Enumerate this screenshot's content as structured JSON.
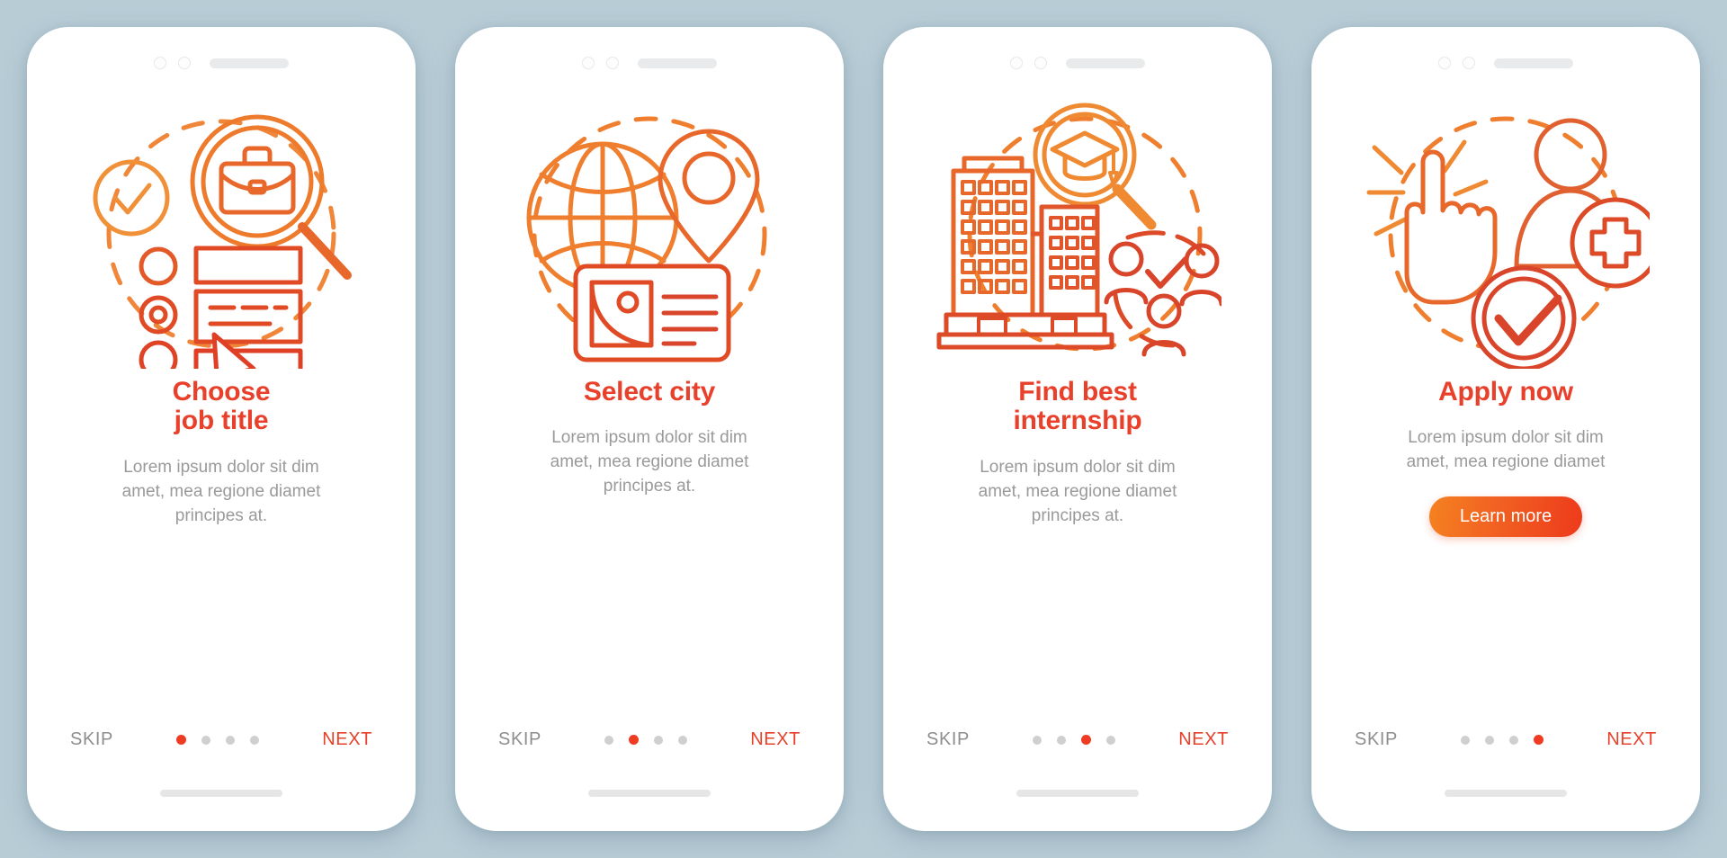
{
  "background_color": "#b8ccd6",
  "accent": {
    "title_red": "#e8402a",
    "dot_active": "#ef3b22",
    "dot_inactive": "#cfcfcf",
    "skip_gray": "#8e8e8e",
    "desc_gray": "#9a9a9a",
    "gradient_start": "#f58220",
    "gradient_end": "#ed3a1c",
    "stroke_orange": "#ef8a33",
    "stroke_red": "#e04b2a"
  },
  "screens": [
    {
      "id": "choose-job-title",
      "illustration_name": "briefcase-magnifier-checklist-illustration",
      "title": "Choose\njob title",
      "description": "Lorem ipsum dolor sit dim\namet, mea regione diamet\nprincipes at.",
      "cta": null,
      "skip_label": "SKIP",
      "next_label": "NEXT",
      "dots_total": 4,
      "dots_active_index": 0
    },
    {
      "id": "select-city",
      "illustration_name": "globe-location-pin-id-card-illustration",
      "title": "Select city",
      "description": "Lorem ipsum dolor sit dim\namet, mea regione diamet\nprincipes at.",
      "cta": null,
      "skip_label": "SKIP",
      "next_label": "NEXT",
      "dots_total": 4,
      "dots_active_index": 1
    },
    {
      "id": "find-best-internship",
      "illustration_name": "buildings-graduation-magnifier-people-illustration",
      "title": "Find best\ninternship",
      "description": "Lorem ipsum dolor sit dim\namet, mea regione diamet\nprincipes at.",
      "cta": null,
      "skip_label": "SKIP",
      "next_label": "NEXT",
      "dots_total": 4,
      "dots_active_index": 2
    },
    {
      "id": "apply-now",
      "illustration_name": "tap-hand-add-user-checkmark-illustration",
      "title": "Apply now",
      "description": "Lorem ipsum dolor sit dim\namet, mea regione diamet",
      "cta": "Learn more",
      "skip_label": "SKIP",
      "next_label": "NEXT",
      "dots_total": 4,
      "dots_active_index": 3
    }
  ]
}
